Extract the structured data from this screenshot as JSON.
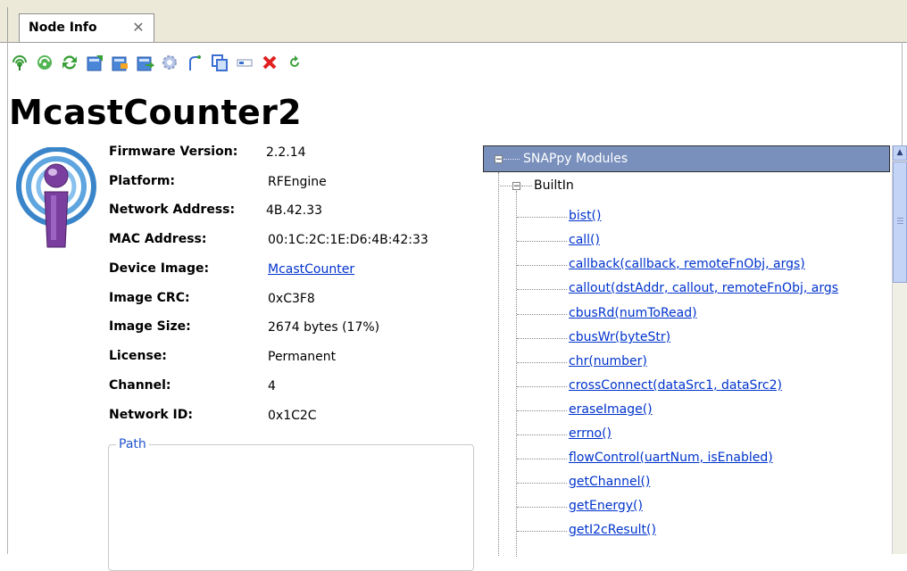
{
  "tab": {
    "label": "Node Info",
    "close_symbol": "✕"
  },
  "toolbar": {
    "icons": [
      "ping-icon",
      "refresh-node-icon",
      "sync-icon",
      "upload-image-icon",
      "erase-image-icon",
      "export-icon",
      "settings-icon",
      "probe-icon",
      "copy-icon",
      "console-icon",
      "delete-icon",
      "reboot-icon"
    ]
  },
  "node": {
    "name": "McastCounter2",
    "fields": [
      {
        "key": "Firmware Version:",
        "value": "2.2.14"
      },
      {
        "key": "Platform:",
        "value": "RFEngine"
      },
      {
        "key": "Network Address:",
        "value": "4B.42.33"
      },
      {
        "key": "MAC Address:",
        "value": "00:1C:2C:1E:D6:4B:42:33"
      },
      {
        "key": "Device Image:",
        "value": "McastCounter"
      },
      {
        "key": "Image CRC:",
        "value": "0xC3F8"
      },
      {
        "key": "Image Size:",
        "value": "2674 bytes (17%)"
      },
      {
        "key": "License:",
        "value": "Permanent"
      },
      {
        "key": "Channel:",
        "value": "4"
      },
      {
        "key": "Network ID:",
        "value": "0x1C2C"
      }
    ],
    "path_label": "Path"
  },
  "tree": {
    "root_label": "SNAPpy Modules",
    "builtin_label": "BuiltIn",
    "functions": [
      "bist()",
      "call()",
      "callback(callback, remoteFnObj, args)",
      "callout(dstAddr, callout, remoteFnObj, args",
      "cbusRd(numToRead)",
      "cbusWr(byteStr)",
      "chr(number)",
      "crossConnect(dataSrc1, dataSrc2)",
      "eraseImage()",
      "errno()",
      "flowControl(uartNum, isEnabled)",
      "getChannel()",
      "getEnergy()",
      "getI2cResult()"
    ]
  },
  "colors": {
    "tree_header_bg": "#7990bd",
    "link": "#0033cc",
    "icon_green": "#3aa03a",
    "icon_blue": "#3a6fd1",
    "icon_red": "#e02020"
  }
}
